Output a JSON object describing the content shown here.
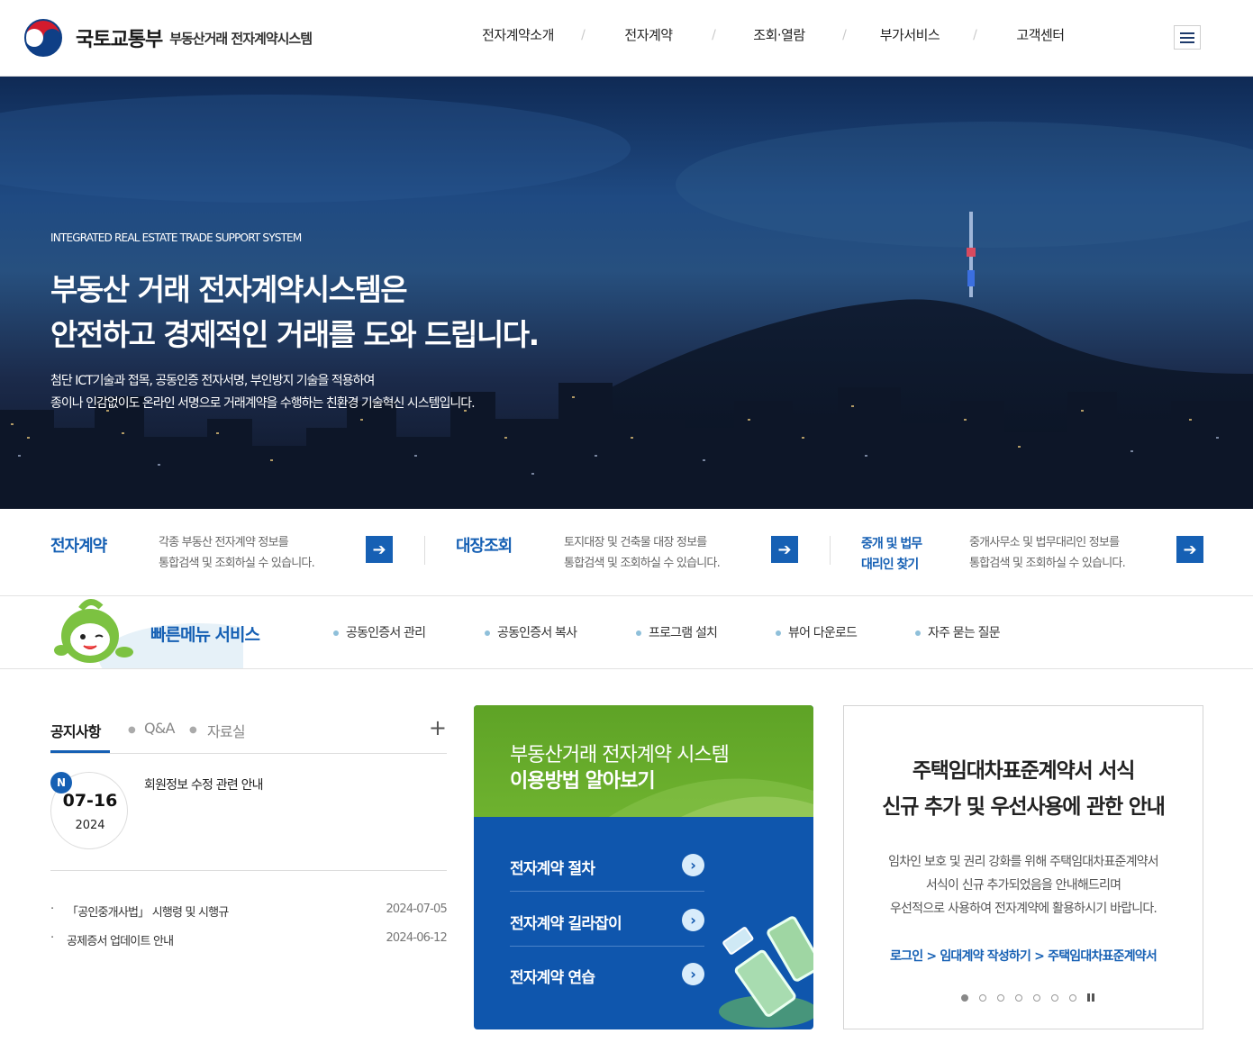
{
  "header": {
    "ministry": "국토교통부",
    "system_name": "부동산거래 전자계약시스템",
    "nav": [
      "전자계약소개",
      "전자계약",
      "조회·열람",
      "부가서비스",
      "고객센터"
    ],
    "separator": "/",
    "menu_icon": "hamburger-icon"
  },
  "hero": {
    "subtitle": "INTEGRATED REAL ESTATE TRADE SUPPORT SYSTEM",
    "title": "부동산 거래 전자계약시스템은\n안전하고 경제적인 거래를 도와 드립니다.",
    "description": "첨단 ICT기술과 접목, 공동인증 전자서명, 부인방지 기술을 적용하여\n종이나 인감없이도 온라인 서명으로 거래계약을 수행하는 친환경 기술혁신 시스템입니다."
  },
  "services": [
    {
      "title": "전자계약",
      "desc": "각종 부동산 전자계약 정보를\n통합검색 및 조회하실 수 있습니다."
    },
    {
      "title": "대장조회",
      "desc": "토지대장 및 건축물 대장 정보를\n통합검색 및 조회하실 수 있습니다."
    },
    {
      "title": "중개 및 법무\n대리인 찾기",
      "desc": "중개사무소 및 법무대리인 정보를\n통합검색 및 조회하실 수 있습니다."
    }
  ],
  "quick_menu": {
    "title": "빠른메뉴 서비스",
    "links": [
      "공동인증서 관리",
      "공동인증서 복사",
      "프로그램 설치",
      "뷰어 다운로드",
      "자주 묻는 질문"
    ]
  },
  "board": {
    "tabs": [
      "공지사항",
      "Q&A",
      "자료실"
    ],
    "more": "+",
    "featured": {
      "badge": "N",
      "date": "07-16",
      "year": "2024",
      "title": "회원정보 수정 관련 안내"
    },
    "items": [
      {
        "bullet": "·",
        "title": "「공인중개사법」 시행령 및 시행규",
        "date": "2024-07-05"
      },
      {
        "bullet": "·",
        "title": "공제증서 업데이트 안내",
        "date": "2024-06-12"
      }
    ]
  },
  "guide": {
    "heading1": "부동산거래 전자계약 시스템",
    "heading2": "이용방법 알아보기",
    "links": [
      "전자계약 절차",
      "전자계약 길라잡이",
      "전자계약 연습"
    ]
  },
  "announcement": {
    "title": "주택임대차표준계약서 서식\n신규 추가 및 우선사용에 관한 안내",
    "body": "임차인 보호 및 권리 강화를 위해 주택임대차표준계약서\n서식이 신규 추가되었음을 안내해드리며\n우선적으로 사용하여 전자계약에 활용하시기 바랍니다.",
    "link": "로그인 > 임대계약 작성하기 > 주택임대차표준계약서",
    "pages": 7,
    "current_page": 1
  },
  "colors": {
    "brand_blue": "#1660b4",
    "guide_green": "#6eb22f",
    "guide_blue": "#0f56ad"
  }
}
